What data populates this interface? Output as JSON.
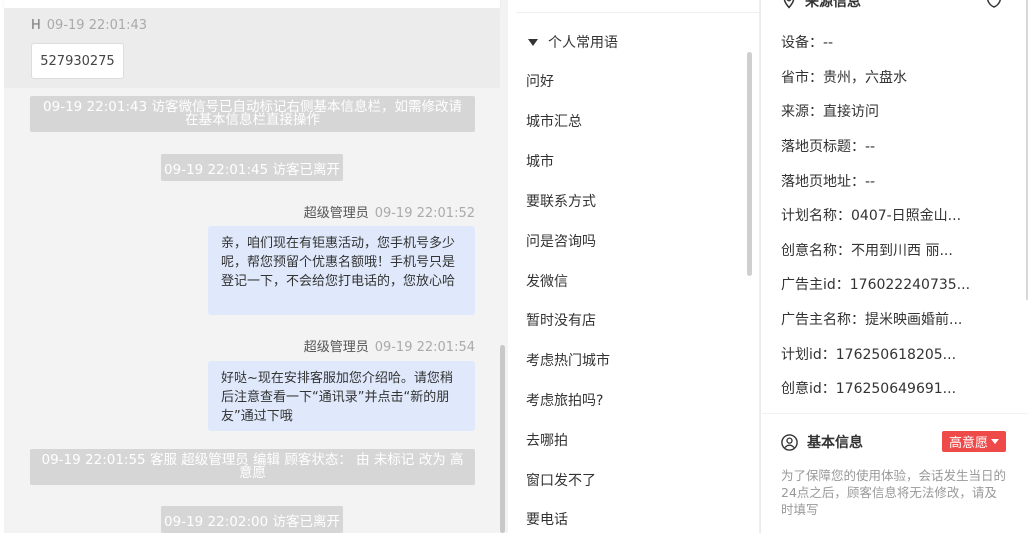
{
  "chat": {
    "visitor_message": {
      "sender": "H",
      "time": "09-19 22:01:43",
      "text": "527930275"
    },
    "system_wechat_notice": "09-19 22:01:43 访客微信号已自动标记右侧基本信息栏，如需修改请在基本信息栏直接操作",
    "system_left_1": "09-19 22:01:45 访客已离开",
    "agent_message_1": {
      "sender": "超级管理员",
      "time": "09-19 22:01:52",
      "text": "亲，咱们现在有钜惠活动，您手机号多少呢，帮您预留个优惠名额哦！手机号只是登记一下，不会给您打电话的，您放心哈"
    },
    "agent_message_2": {
      "sender": "超级管理员",
      "time": "09-19 22:01:54",
      "text": "好哒~现在安排客服加您介绍哈。请您稍后注意查看一下“通讯录”并点击“新的朋友”通过下哦"
    },
    "system_status_change": "09-19 22:01:55 客服 超级管理员 编辑 顾客状态： 由 未标记 改为 高意愿",
    "system_left_2": "09-19 22:02:00 访客已离开"
  },
  "phrases": {
    "header": "个人常用语",
    "items": [
      "问好",
      "城市汇总",
      "城市",
      "要联系方式",
      "问是咨询吗",
      "发微信",
      "暂时没有店",
      "考虑热门城市",
      "考虑旅拍吗?",
      "去哪拍",
      "窗口发不了",
      "要电话"
    ]
  },
  "info": {
    "source_title": "来源信息",
    "rows": [
      "设备：--",
      "省市：贵州，六盘水",
      "来源：直接访问",
      "落地页标题：--",
      "落地页地址：--",
      "计划名称：0407-日照金山...",
      "创意名称：不用到川西 丽...",
      "广告主id：176022240735...",
      "广告主名称：提米映画婚前...",
      "计划id：176250618205...",
      "创意id：176250649691..."
    ],
    "basic_title": "基本信息",
    "intent_badge": "高意愿",
    "notice": "为了保障您的使用体验，会话发生当日的24点之后，顾客信息将无法修改，请及时填写"
  },
  "colors": {
    "agent_bubble": "#dfe9fb",
    "system_bar": "#d6d6d6",
    "intent_badge": "#ef4a4a"
  },
  "icons": [
    "location-icon",
    "shield-icon",
    "user-circle-icon",
    "triangle-down-icon",
    "caret-down-icon"
  ]
}
